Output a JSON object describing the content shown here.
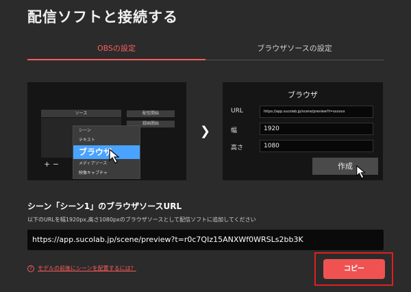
{
  "page": {
    "title": "配信ソフトと接続する"
  },
  "tabs": [
    {
      "label": "OBSの設定",
      "active": true
    },
    {
      "label": "ブラウザソースの設定",
      "active": false
    }
  ],
  "obs_illustration": {
    "sources_header": "ソース",
    "buttons": [
      "配信開始",
      "録画開始"
    ],
    "add_remove": "+ −",
    "menu_items": [
      "シーン",
      "テキスト",
      "ブラウザ",
      "メディアソース",
      "映像キャプチャ"
    ],
    "highlighted_item": "ブラウザ"
  },
  "browser_dialog": {
    "title": "ブラウザ",
    "url_label": "URL",
    "url_value": "https://app.sucolab.jp/scene/preview?t=xxxxxx",
    "width_label": "幅",
    "width_value": "1920",
    "height_label": "高さ",
    "height_value": "1080",
    "create_label": "作成"
  },
  "section": {
    "heading": "シーン「シーン1」のブラウザソースURL",
    "description": "以下のURLを幅1920px,高さ1080pxのブラウザソースとして配信ソフトに追加してください",
    "url": "https://app.sucolab.jp/scene/preview?t=r0c7QIz15ANXWf0WRSLs2bb3K"
  },
  "help_link": {
    "icon": "question-circle-icon",
    "label": "モデルの前後にシーンを配置するには？"
  },
  "copy_button": {
    "label": "コピー"
  },
  "colors": {
    "accent": "#f05252",
    "highlight_box": "#e02020",
    "menu_highlight": "#4aa3ff",
    "background": "#2b2b2b"
  }
}
